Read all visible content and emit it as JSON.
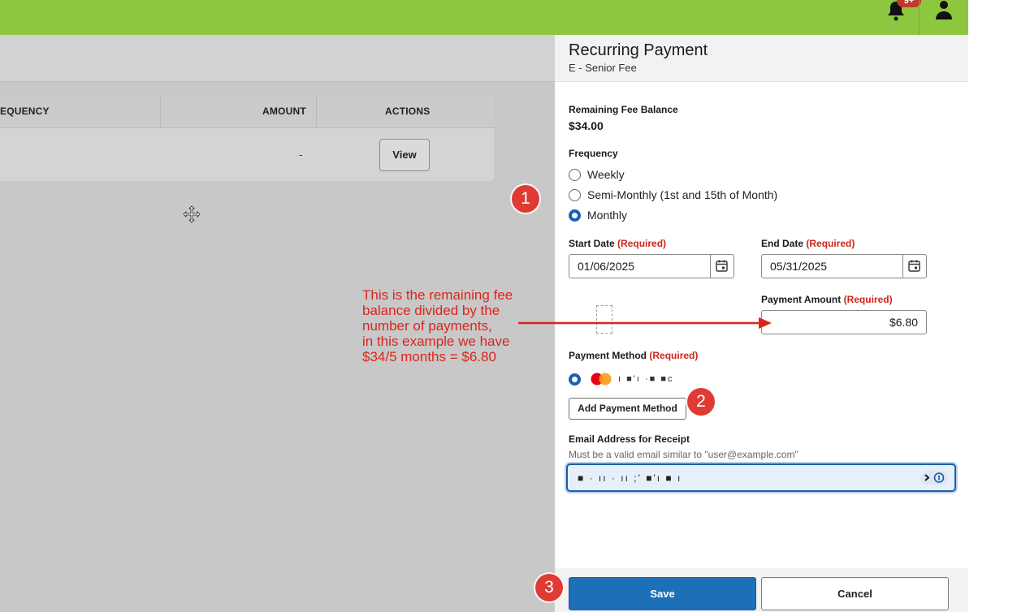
{
  "topbar": {
    "notification_count": "9+",
    "brand_color": "#8dc63f"
  },
  "background_table": {
    "columns": [
      "EQUENCY",
      "AMOUNT",
      "ACTIONS"
    ],
    "row": {
      "amount": "-",
      "action_label": "View"
    }
  },
  "annotation": {
    "lines": [
      "This is the remaining fee",
      "balance divided by the",
      "number of payments,",
      "in this example we have",
      "$34/5 months = $6.80"
    ],
    "steps": [
      "1",
      "2",
      "3"
    ],
    "color": "#d9261c"
  },
  "panel": {
    "title": "Recurring Payment",
    "subtitle": "E - Senior Fee",
    "balance_label": "Remaining Fee Balance",
    "balance_value": "$34.00",
    "frequency_label": "Frequency",
    "frequency_options": [
      "Weekly",
      "Semi-Monthly (1st and 15th of Month)",
      "Monthly"
    ],
    "frequency_selected": "Monthly",
    "start_date_label": "Start Date",
    "end_date_label": "End Date",
    "required_tag": "(Required)",
    "start_date": "01/06/2025",
    "end_date": "05/31/2025",
    "payment_amount_label": "Payment Amount",
    "payment_amount": "$6.80",
    "payment_method_label": "Payment Method",
    "payment_method_masked": "ı ■'ı ·■ ■c",
    "add_payment_method": "Add Payment Method",
    "email_label": "Email Address for Receipt",
    "email_hint": "Must be a valid email similar to \"user@example.com\"",
    "email_value_masked": "■ · ıı · ıı ;' ■'ı ■ ı",
    "save": "Save",
    "cancel": "Cancel",
    "primary_color": "#1d6fb8",
    "required_color": "#d0241b"
  }
}
